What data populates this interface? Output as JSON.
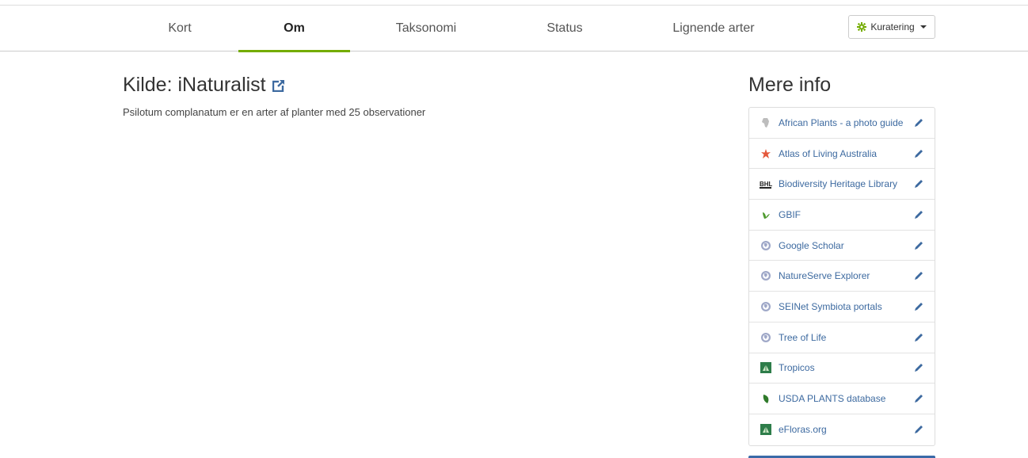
{
  "tabs": [
    {
      "label": "Kort"
    },
    {
      "label": "Om"
    },
    {
      "label": "Taksonomi"
    },
    {
      "label": "Status"
    },
    {
      "label": "Lignende arter"
    }
  ],
  "curate": {
    "label": "Kuratering"
  },
  "main": {
    "title": "Kilde: iNaturalist",
    "description": "Psilotum complanatum er en arter af planter med 25 observationer"
  },
  "side": {
    "title": "Mere info",
    "items": [
      {
        "label": "African Plants - a photo guide",
        "icon": "african-plants-icon"
      },
      {
        "label": "Atlas of Living Australia",
        "icon": "ala-icon"
      },
      {
        "label": "Biodiversity Heritage Library",
        "icon": "bhl-icon"
      },
      {
        "label": "GBIF",
        "icon": "gbif-icon"
      },
      {
        "label": "Google Scholar",
        "icon": "globe-icon"
      },
      {
        "label": "NatureServe Explorer",
        "icon": "globe-icon"
      },
      {
        "label": "SEINet Symbiota portals",
        "icon": "globe-icon"
      },
      {
        "label": "Tree of Life",
        "icon": "globe-icon"
      },
      {
        "label": "Tropicos",
        "icon": "tropicos-icon"
      },
      {
        "label": "USDA PLANTS database",
        "icon": "usda-leaf-icon"
      },
      {
        "label": "eFloras.org",
        "icon": "efloras-icon"
      }
    ]
  },
  "colors": {
    "accent": "#74ac00",
    "link": "#3d6aa0"
  }
}
